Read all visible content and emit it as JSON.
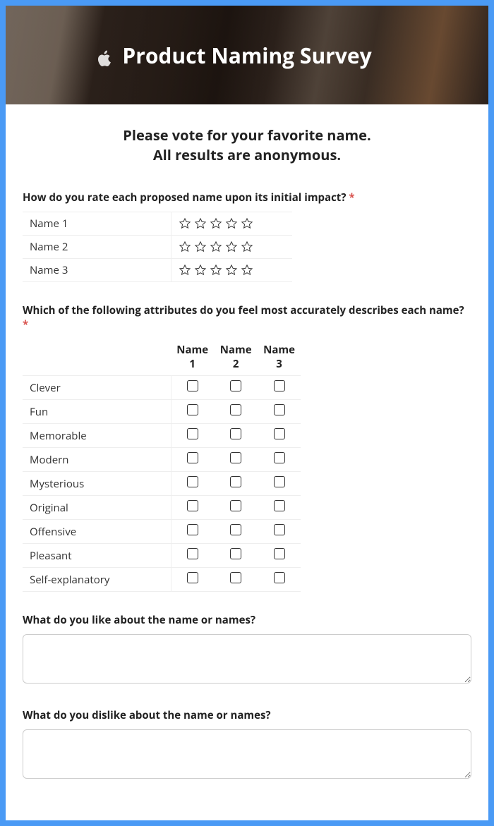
{
  "header": {
    "title": "Product Naming Survey"
  },
  "intro": {
    "line1": "Please vote for your favorite name.",
    "line2": "All results are anonymous."
  },
  "q_rating": {
    "label": "How do you rate each proposed name upon its initial impact?",
    "required_marker": "*",
    "rows": [
      "Name 1",
      "Name 2",
      "Name 3"
    ]
  },
  "q_attributes": {
    "label": "Which of the following attributes do you feel most accurately describes each name?",
    "required_marker": "*",
    "columns": [
      "Name 1",
      "Name 2",
      "Name 3"
    ],
    "rows": [
      "Clever",
      "Fun",
      "Memorable",
      "Modern",
      "Mysterious",
      "Original",
      "Offensive",
      "Pleasant",
      "Self-explanatory"
    ]
  },
  "q_like": {
    "label": "What do you like about the name or names?"
  },
  "q_dislike": {
    "label": "What do you dislike about the name or names?"
  }
}
